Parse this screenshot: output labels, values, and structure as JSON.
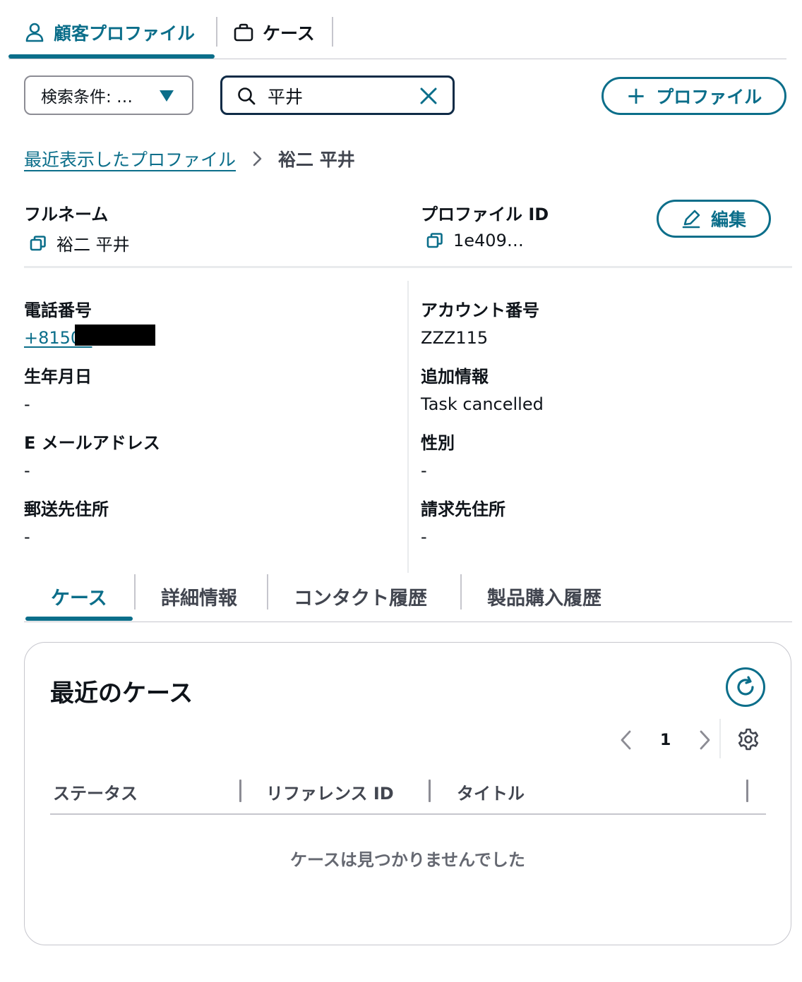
{
  "top_tabs": {
    "profile": "顧客プロファイル",
    "cases": "ケース"
  },
  "search": {
    "filter_label": "検索条件: …",
    "query": "平井",
    "add_profile_label": "プロファイル"
  },
  "breadcrumb": {
    "link": "最近表示したプロファイル",
    "current": "裕二 平井"
  },
  "profile": {
    "full_name_label": "フルネーム",
    "full_name": "裕二 平井",
    "profile_id_label": "プロファイル ID",
    "profile_id": "1e409…",
    "edit_label": "編集"
  },
  "details": {
    "phone_label": "電話番号",
    "phone": "+81505",
    "account_label": "アカウント番号",
    "account": "ZZZ115",
    "birthdate_label": "生年月日",
    "birthdate": "-",
    "additional_label": "追加情報",
    "additional": "Task cancelled",
    "email_label": "E メールアドレス",
    "email": "-",
    "gender_label": "性別",
    "gender": "-",
    "mailing_label": "郵送先住所",
    "mailing": "-",
    "billing_label": "請求先住所",
    "billing": "-"
  },
  "content_tabs": {
    "cases": "ケース",
    "details": "詳細情報",
    "contact_history": "コンタクト履歴",
    "purchase_history": "製品購入履歴"
  },
  "recent_cases": {
    "title": "最近のケース",
    "page": "1",
    "columns": [
      "ステータス",
      "リファレンス ID",
      "タイトル"
    ],
    "empty": "ケースは見つかりませんでした"
  },
  "colors": {
    "accent": "#0b6e8a",
    "text": "#0f141a",
    "muted": "#424650"
  }
}
